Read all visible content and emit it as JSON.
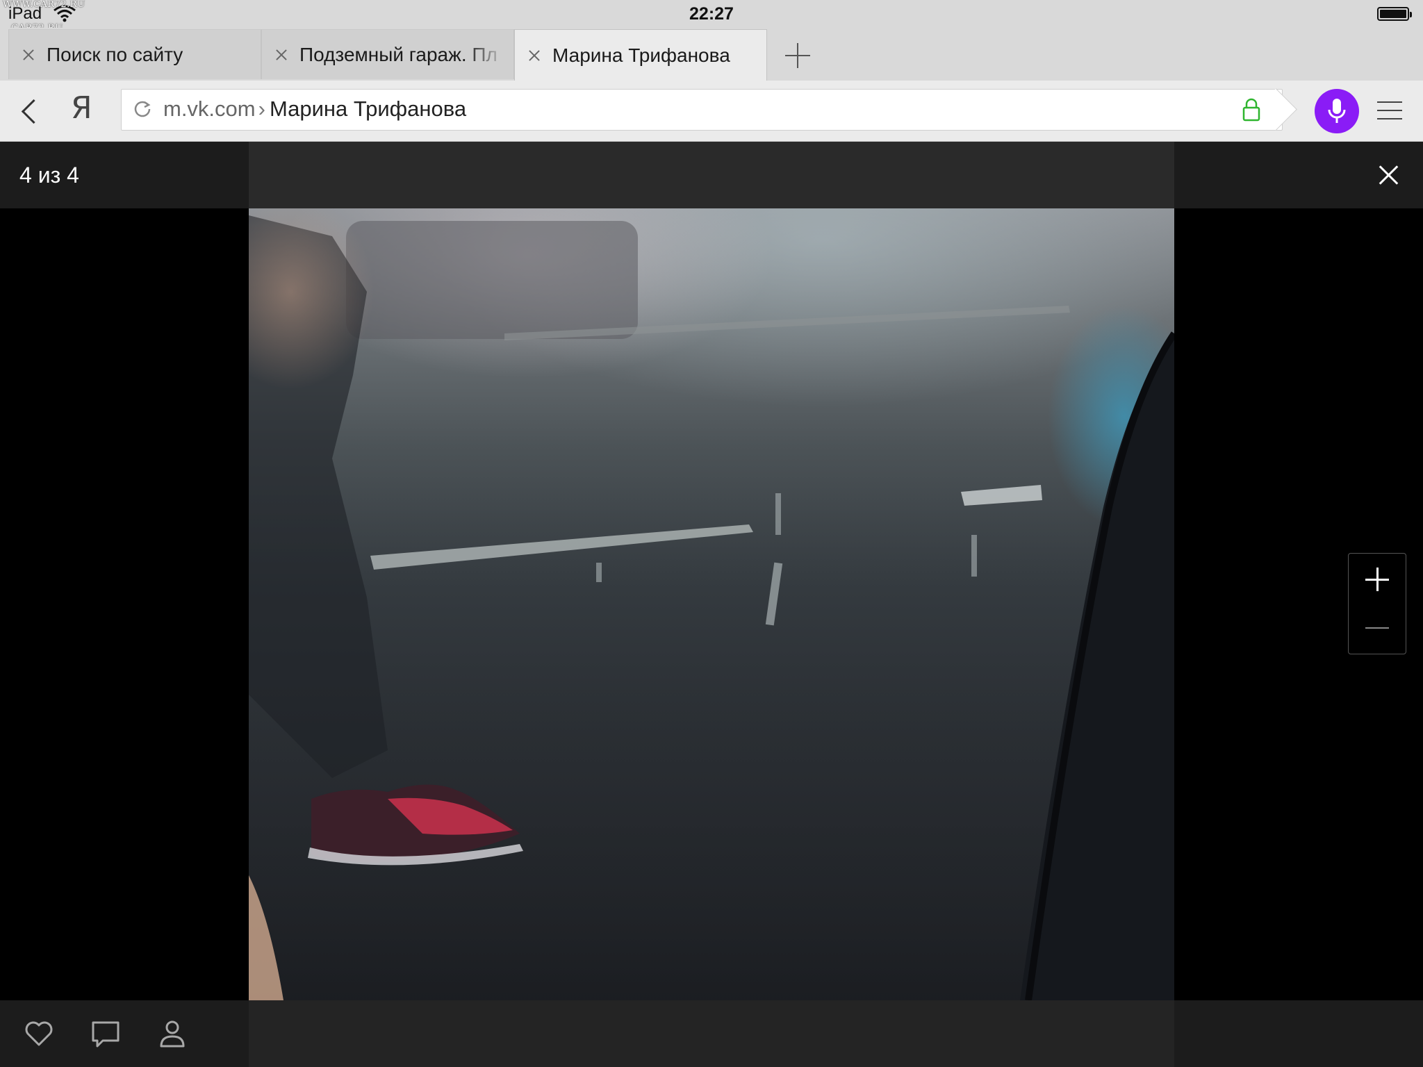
{
  "status_bar": {
    "device": "iPad",
    "time": "22:27",
    "watermark_top": "WWW.CAR72.RU",
    "watermark_bottom": "CAR72.RU"
  },
  "tabs": [
    {
      "title": "Поиск по сайту",
      "active": false
    },
    {
      "title": "Подземный гараж. Пл",
      "active": false
    },
    {
      "title": "Марина Трифанова",
      "active": true
    }
  ],
  "address_bar": {
    "browser_logo": "Я",
    "domain": "m.vk.com",
    "separator": "›",
    "page_title": "Марина Трифанова",
    "lock_color": "#2fb52f",
    "mic_color": "#8a1cf6"
  },
  "viewer": {
    "counter": "4 из 4",
    "icons": [
      "close-icon",
      "zoom-in-icon",
      "zoom-out-icon",
      "heart-icon",
      "comment-icon",
      "person-icon"
    ]
  }
}
